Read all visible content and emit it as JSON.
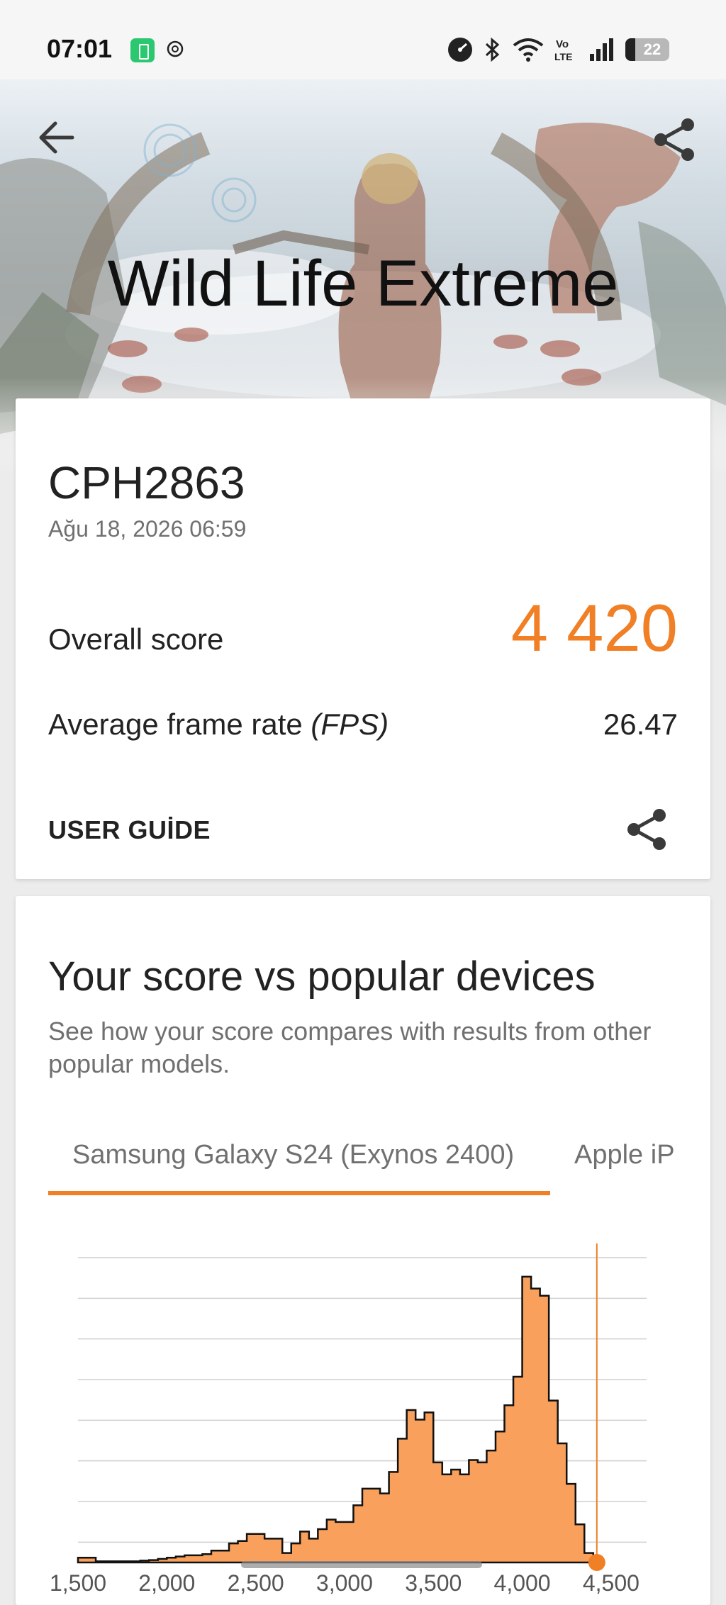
{
  "status_bar": {
    "time": "07:01",
    "battery_level": "22",
    "icons": [
      "speed-icon",
      "bluetooth-icon",
      "wifi-icon",
      "volte-icon",
      "signal-icon",
      "battery-icon"
    ]
  },
  "header": {
    "title": "Wild Life Extreme"
  },
  "result": {
    "device_name": "CPH2863",
    "date": "Ağu 18, 2026 06:59",
    "overall_label": "Overall score",
    "overall_value": "4 420",
    "fps_label_prefix": "Average frame rate ",
    "fps_label_unit": "(FPS)",
    "fps_value": "26.47",
    "user_guide_label": "USER GUİDE"
  },
  "comparison": {
    "title": "Your score vs popular devices",
    "description": "See how your score compares with results from other popular models.",
    "tabs": [
      {
        "label": "Samsung Galaxy S24 (Exynos 2400)",
        "active": true
      },
      {
        "label": "Apple iP",
        "active": false
      }
    ]
  },
  "colors": {
    "accent": "#f07f25",
    "histogram_fill": "#f9a15c",
    "histogram_stroke": "#111111"
  },
  "chart_data": {
    "type": "area",
    "x_domain": [
      1500,
      4700
    ],
    "x_tick_values": [
      1500,
      2000,
      2500,
      3000,
      3500,
      4000,
      4500
    ],
    "your_score": 4420,
    "bins_start": 1500,
    "bin_width": 50,
    "values": [
      2,
      2,
      0.5,
      0.5,
      0.5,
      0.5,
      0.5,
      0.8,
      1,
      1.5,
      2,
      2.5,
      3,
      3,
      3.5,
      5,
      5,
      8,
      9,
      12,
      12,
      10,
      10,
      4,
      8,
      13,
      10,
      14,
      18,
      17,
      17,
      24,
      31,
      31,
      29,
      38,
      52,
      64,
      60,
      63,
      42,
      37,
      39,
      37,
      43,
      42,
      47,
      55,
      66,
      78,
      120,
      115,
      112,
      68,
      50,
      33,
      16,
      4,
      1
    ]
  }
}
